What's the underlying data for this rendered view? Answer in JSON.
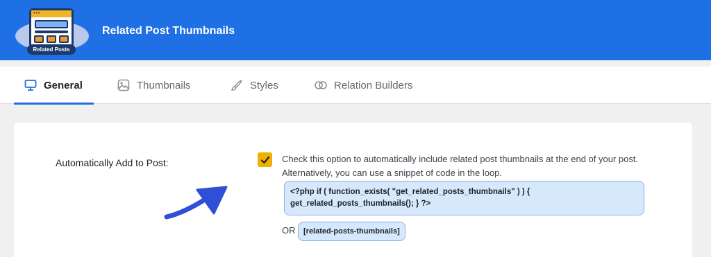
{
  "header": {
    "title": "Related Post Thumbnails",
    "logo_label": "Related Posts",
    "logo_dots": "•••"
  },
  "tabs": [
    {
      "label": "General",
      "icon": "monitor-icon",
      "active": true
    },
    {
      "label": "Thumbnails",
      "icon": "image-icon",
      "active": false
    },
    {
      "label": "Styles",
      "icon": "brush-icon",
      "active": false
    },
    {
      "label": "Relation Builders",
      "icon": "link-circles-icon",
      "active": false
    }
  ],
  "settings": {
    "auto_add": {
      "label": "Automatically Add to Post:",
      "checked": true,
      "description_line1": "Check this option to automatically include related post thumbnails at the end of your post.",
      "description_line2": "Alternatively, you can use a snippet of code in the loop.",
      "code_line1": "<?php if ( function_exists( \"get_related_posts_thumbnails\" ) ) {",
      "code_line2": "get_related_posts_thumbnails(); } ?>",
      "or_text": "OR",
      "shortcode": "[related-posts-thumbnails]"
    }
  },
  "colors": {
    "header_bg": "#1f6fe5",
    "accent": "#1f6fe5",
    "checkbox": "#f0b000",
    "code_bg": "#d6e8fb",
    "arrow": "#2f4fd6"
  }
}
